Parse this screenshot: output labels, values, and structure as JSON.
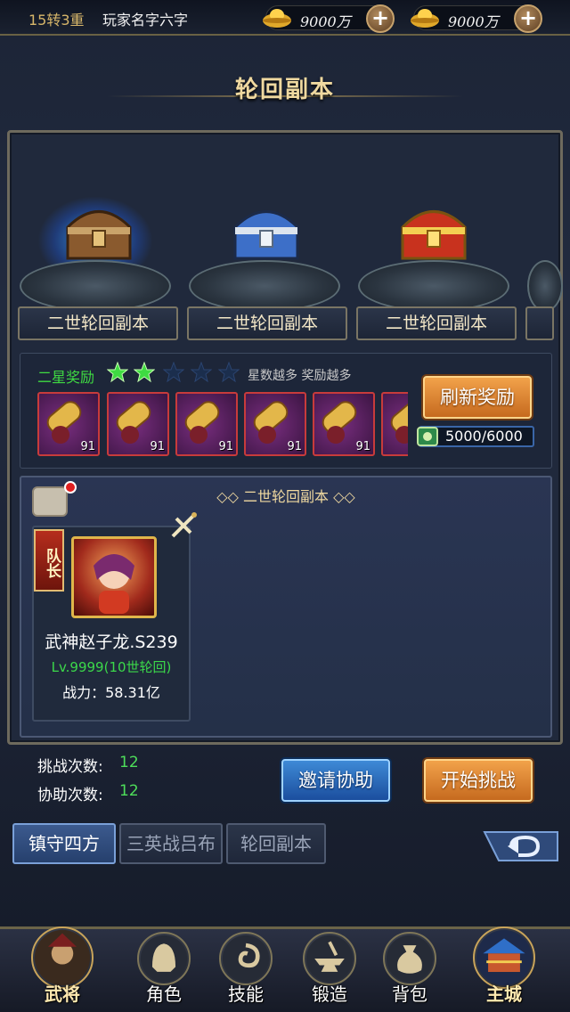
{
  "topbar": {
    "reincarnation": "15转3重",
    "player_name": "玩家名字六字",
    "currency1": "9000万",
    "currency2": "9000万"
  },
  "title": "轮回副本",
  "dungeons": [
    {
      "name": "二世轮回副本",
      "chest": "bronze",
      "selected": true
    },
    {
      "name": "二世轮回副本",
      "chest": "silver",
      "selected": false
    },
    {
      "name": "二世轮回副本",
      "chest": "gold",
      "selected": false
    }
  ],
  "reward": {
    "star_label": "二星奖励",
    "stars_filled": 2,
    "stars_total": 5,
    "hint": "星数越多 奖励越多",
    "items": [
      {
        "count": "91"
      },
      {
        "count": "91"
      },
      {
        "count": "91"
      },
      {
        "count": "91"
      },
      {
        "count": "91"
      },
      {
        "count": ""
      }
    ],
    "refresh_label": "刷新奖励",
    "cost": "5000/6000"
  },
  "team": {
    "title": "二世轮回副本",
    "captain_label": "队长",
    "hero_name": "武神赵子龙.S239",
    "hero_level": "Lv.9999(10世轮回)",
    "power_label": "战力：",
    "power_value": "58.31亿"
  },
  "stats": {
    "challenge_label": "挑战次数:",
    "challenge_value": "12",
    "assist_label": "协助次数:",
    "assist_value": "12"
  },
  "buttons": {
    "invite": "邀请协助",
    "start": "开始挑战"
  },
  "tabs": [
    "镇守四方",
    "三英战吕布",
    "轮回副本"
  ],
  "nav": {
    "general": "武将",
    "role": "角色",
    "skill": "技能",
    "forge": "锻造",
    "bag": "背包",
    "city": "主城"
  },
  "colors": {
    "green_text": "#3fdb42",
    "gold_text": "#f0d9a0",
    "orange_button": "#e08a35",
    "blue_button": "#2c6cc0"
  }
}
